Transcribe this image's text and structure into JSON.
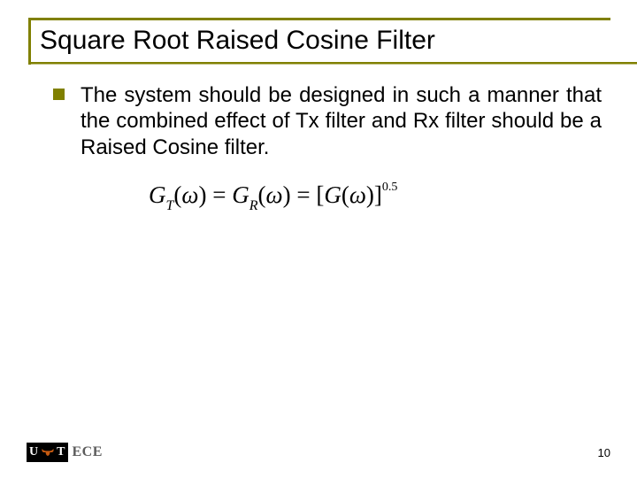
{
  "title": "Square Root Raised Cosine Filter",
  "bullet": {
    "text": "The system should be designed in such a manner that the combined effect of Tx filter and Rx filter should be a Raised Cosine filter."
  },
  "equation": {
    "lhs1_fn": "G",
    "lhs1_sub": "T",
    "lhs2_fn": "G",
    "lhs2_sub": "R",
    "rhs_fn": "G",
    "exp": "0.5",
    "omega": "ω",
    "eq": "=",
    "lp": "(",
    "rp": ")",
    "lb": "[",
    "rb": "]"
  },
  "footer": {
    "logo_ut": "UT",
    "logo_ece": "ECE",
    "page": "10"
  }
}
